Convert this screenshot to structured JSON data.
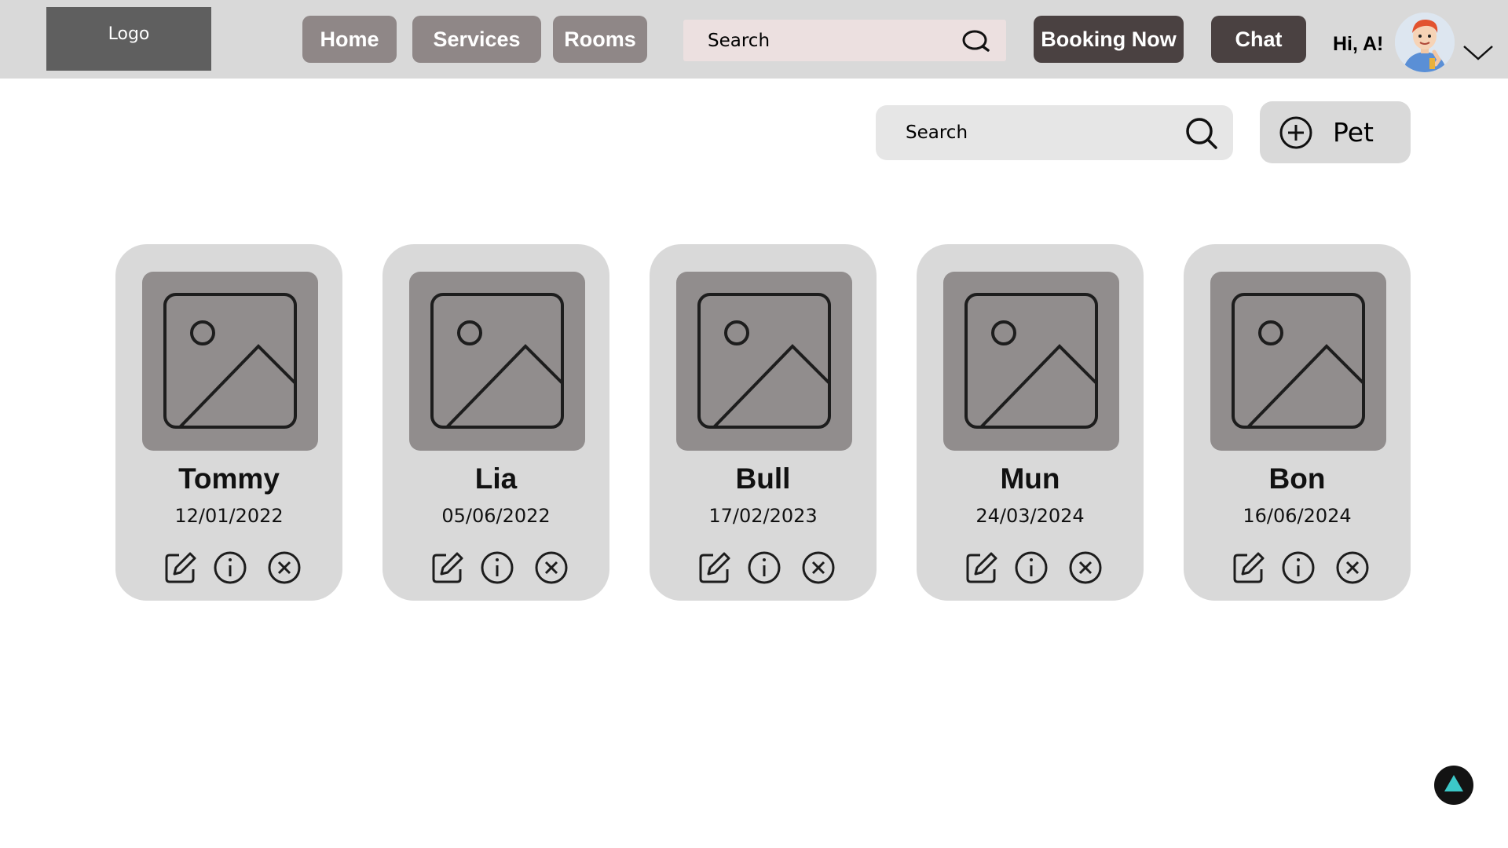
{
  "header": {
    "logo": "Logo",
    "nav": [
      {
        "label": "Home"
      },
      {
        "label": "Services"
      },
      {
        "label": "Rooms"
      }
    ],
    "search": {
      "placeholder": "Search"
    },
    "booking_label": "Booking Now",
    "chat_label": "Chat",
    "greeting": "Hi, A!"
  },
  "toolbar": {
    "search_placeholder": "Search",
    "add_label": "Pet"
  },
  "pets": [
    {
      "name": "Tommy",
      "date": "12/01/2022"
    },
    {
      "name": "Lia",
      "date": "05/06/2022"
    },
    {
      "name": "Bull",
      "date": "17/02/2023"
    },
    {
      "name": "Mun",
      "date": "24/03/2024"
    },
    {
      "name": "Bon",
      "date": "16/06/2024"
    }
  ],
  "colors": {
    "topbar": "#d9d9d9",
    "nav_button": "#8f8787",
    "dark_button": "#4a4141",
    "card": "#d9d9d9",
    "thumbnail": "#918d8d",
    "scroll_top_arrow": "#3cc8c8"
  },
  "icons": {
    "search": "search-icon",
    "add": "plus-circle-icon",
    "edit": "edit-icon",
    "info": "info-icon",
    "delete": "close-circle-icon",
    "scroll_top": "arrow-up-icon",
    "menu": "chevron-down-icon"
  }
}
